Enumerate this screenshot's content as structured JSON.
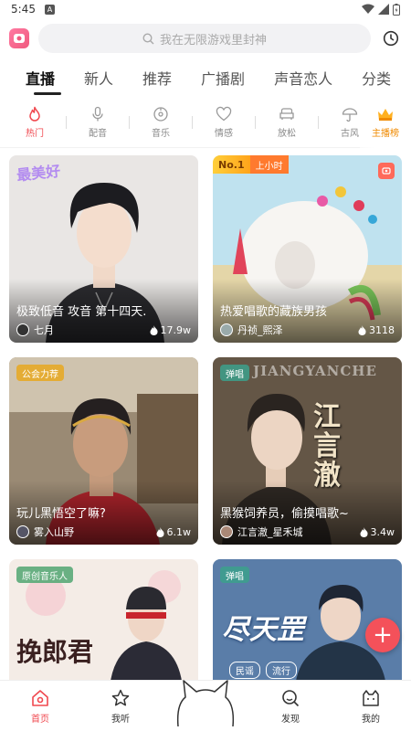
{
  "status": {
    "time": "5:45",
    "notif_glyph": "A"
  },
  "search": {
    "placeholder": "我在无限游戏里封神"
  },
  "tabs": [
    {
      "label": "直播",
      "active": true
    },
    {
      "label": "新人"
    },
    {
      "label": "推荐"
    },
    {
      "label": "广播剧"
    },
    {
      "label": "声音恋人"
    },
    {
      "label": "分类"
    }
  ],
  "categories": [
    {
      "label": "热门",
      "icon": "flame-icon",
      "active": true
    },
    {
      "label": "配音",
      "icon": "microphone-icon"
    },
    {
      "label": "音乐",
      "icon": "music-disc-icon"
    },
    {
      "label": "情感",
      "icon": "heart-icon"
    },
    {
      "label": "放松",
      "icon": "sofa-icon"
    },
    {
      "label": "古风",
      "icon": "umbrella-icon"
    }
  ],
  "rank_entry": {
    "label": "主播榜",
    "icon": "crown-icon"
  },
  "cards": [
    {
      "title": "极致低音 攻音 第十四天.",
      "host": "七月",
      "heat": "17.9w",
      "overlay": "最美好"
    },
    {
      "title": "热爱唱歌的藏族男孩",
      "host": "丹祯_熙泽",
      "heat": "3118",
      "badge_no1": "No.1",
      "badge_hour": "上小时"
    },
    {
      "title": "玩儿黑悟空了嘛?",
      "host": "雾入山野",
      "heat": "6.1w",
      "tag": "公会力荐"
    },
    {
      "title": "黑猴饲养员，偷摸唱歌~",
      "host": "江言澈_星禾城",
      "heat": "3.4w",
      "tag": "弹唱",
      "overlay": "江言澈",
      "overlay_top": "JIANGYANCHE"
    },
    {
      "title": "",
      "host": "",
      "heat": "",
      "tag": "原创音乐人",
      "overlay": "挽郎君"
    },
    {
      "title": "",
      "host": "",
      "heat": "",
      "tag": "弹唱",
      "overlay": "尽天罡",
      "chips": [
        "民谣",
        "流行"
      ]
    }
  ],
  "fab": {
    "label": "+"
  },
  "nav": [
    {
      "label": "首页",
      "icon": "home-icon",
      "active": true
    },
    {
      "label": "我听",
      "icon": "star-icon"
    },
    {
      "label": "",
      "icon": "cat-mascot-icon"
    },
    {
      "label": "发现",
      "icon": "discover-icon"
    },
    {
      "label": "我的",
      "icon": "cat-face-icon"
    }
  ],
  "colors": {
    "accent": "#f0484f",
    "rank": "#f08a00",
    "fab": "#f4515a"
  }
}
